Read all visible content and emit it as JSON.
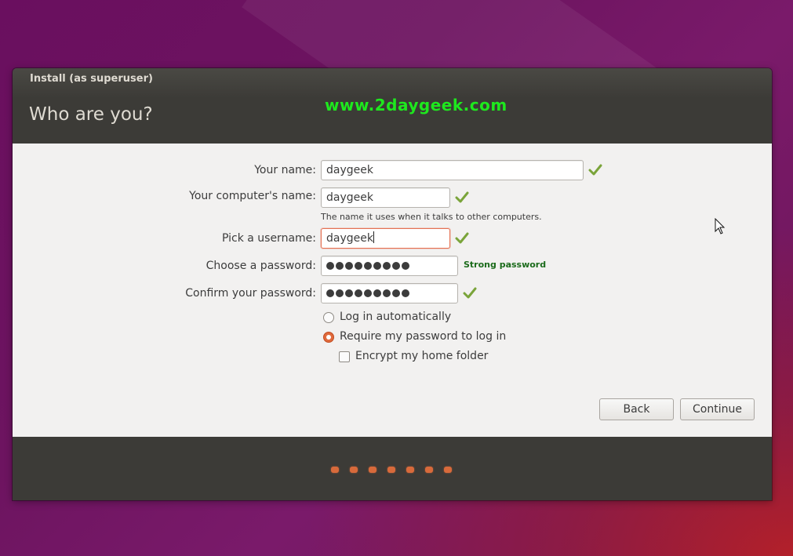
{
  "window": {
    "title": "Install (as superuser)",
    "page_title": "Who are you?",
    "watermark": "www.2daygeek.com"
  },
  "form": {
    "name_label": "Your name:",
    "name_value": "daygeek",
    "computer_label": "Your computer's name:",
    "computer_value": "daygeek",
    "computer_hint": "The name it uses when it talks to other computers.",
    "username_label": "Pick a username:",
    "username_value": "daygeek",
    "password_label": "Choose a password:",
    "password_strength": "Strong password",
    "confirm_label": "Confirm your password:",
    "password_dots": 9,
    "login_auto_label": "Log in automatically",
    "login_require_label": "Require my password to log in",
    "encrypt_label": "Encrypt my home folder",
    "login_selected": "require",
    "encrypt_checked": false
  },
  "buttons": {
    "back": "Back",
    "continue": "Continue"
  },
  "progress": {
    "steps": 7
  },
  "colors": {
    "accent": "#e06a3c",
    "header_bg": "#3c3b37",
    "content_bg": "#f2f1f0",
    "check": "#7aa43a",
    "strength": "#1b6b1b",
    "watermark": "#1ee81e"
  }
}
